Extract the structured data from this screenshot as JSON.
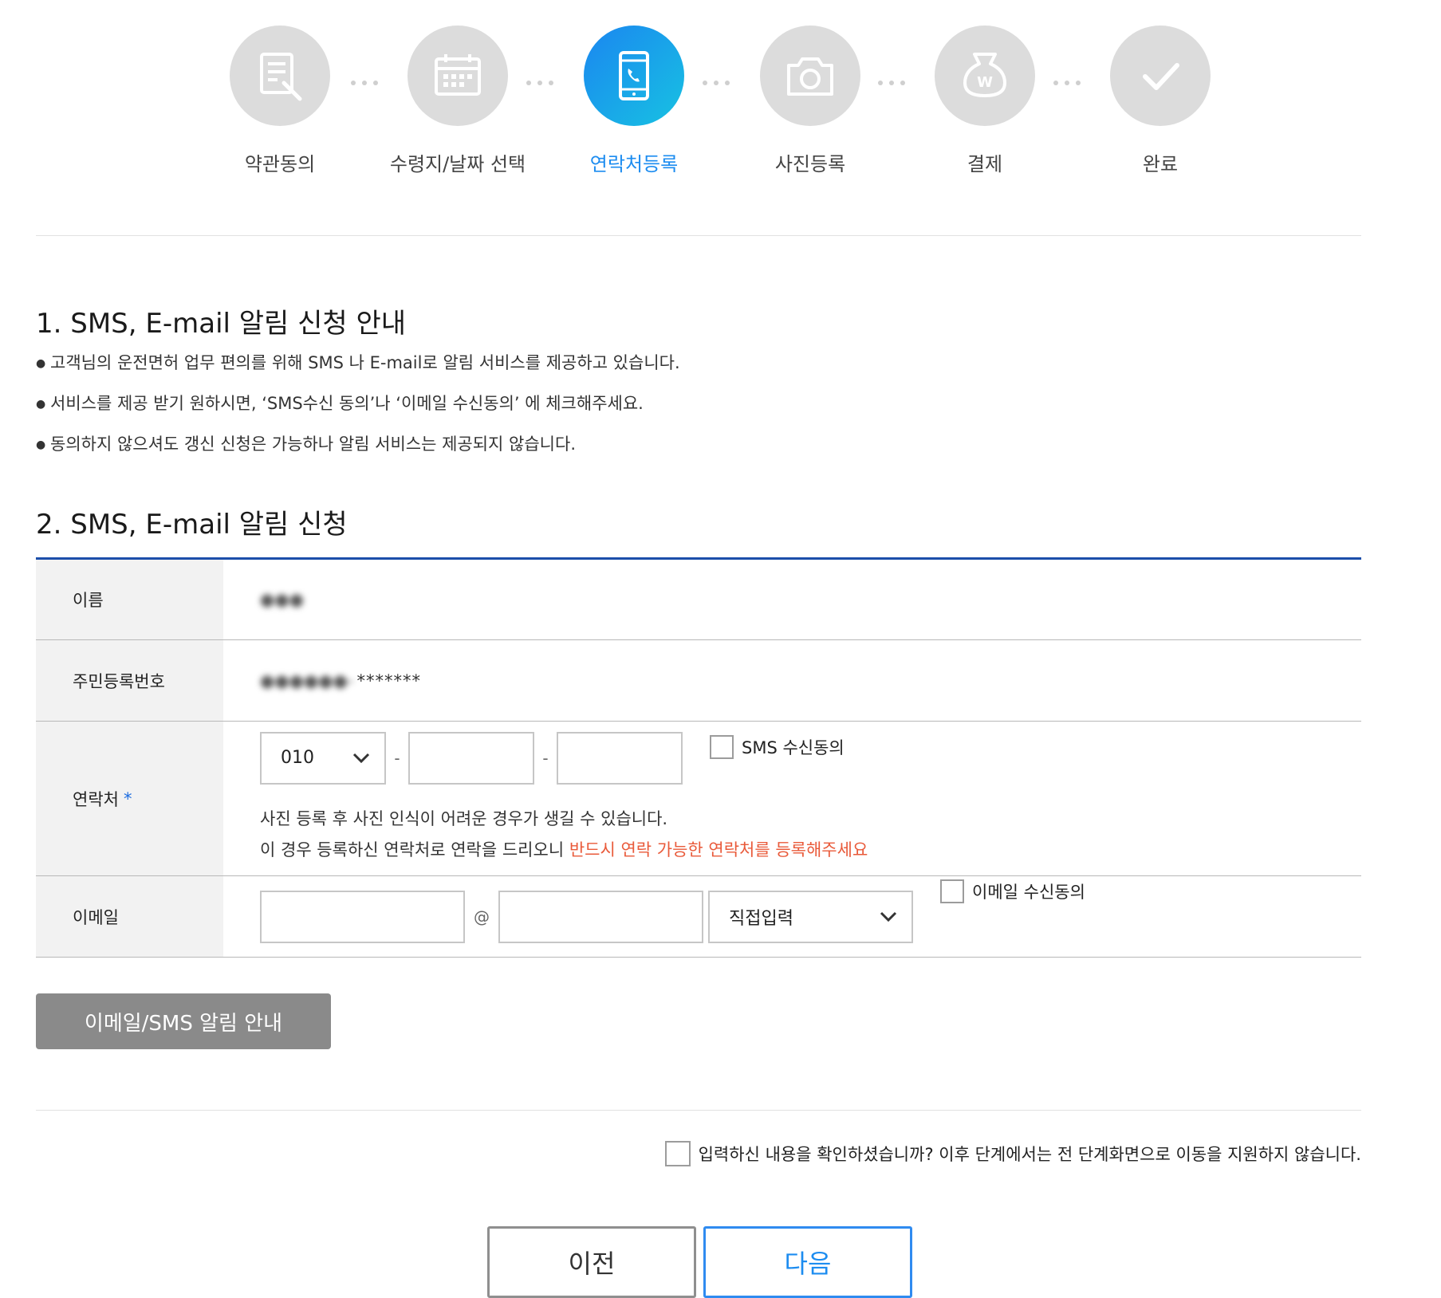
{
  "steps": [
    {
      "label": "약관동의",
      "icon": "document-edit-icon",
      "active": false
    },
    {
      "label": "수령지/날짜 선택",
      "icon": "calendar-icon",
      "active": false
    },
    {
      "label": "연락처등록",
      "icon": "smartphone-call-icon",
      "active": true
    },
    {
      "label": "사진등록",
      "icon": "camera-icon",
      "active": false
    },
    {
      "label": "결제",
      "icon": "won-pouch-icon",
      "active": false
    },
    {
      "label": "완료",
      "icon": "checkmark-icon",
      "active": false
    }
  ],
  "section1": {
    "title": "1. SMS, E-mail 알림 신청 안내",
    "bullets": [
      "고객님의 운전면허 업무 편의를 위해 SMS 나 E-mail로 알림 서비스를 제공하고 있습니다.",
      "서비스를 제공 받기 원하시면, ‘SMS수신 동의’나 ‘이메일 수신동의’ 에 체크해주세요.",
      "동의하지 않으셔도 갱신 신청은 가능하나 알림 서비스는 제공되지 않습니다."
    ]
  },
  "section2": {
    "title": "2. SMS, E-mail 알림 신청",
    "name": {
      "label": "이름",
      "value": "●●●"
    },
    "rrn": {
      "label": "주민등록번호",
      "value_masked": "●●●●●●-",
      "stars": "*******"
    },
    "phone": {
      "label": "연락처",
      "required_mark": "*",
      "prefix": "010",
      "separator": "-",
      "middle": "",
      "last": "",
      "sms_consent_label": "SMS 수신동의",
      "sms_consent_checked": false,
      "notice_line1": "사진 등록 후 사진 인식이 어려운 경우가 생길 수 있습니다.",
      "notice_line2_prefix": "이 경우 등록하신 연락처로 연락을 드리오니 ",
      "notice_line2_highlight": "반드시 연락 가능한 연락처를 등록해주세요"
    },
    "email": {
      "label": "이메일",
      "local": "",
      "at": "@",
      "domain": "",
      "domain_select": "직접입력",
      "consent_label": "이메일 수신동의",
      "consent_checked": false
    }
  },
  "guide_button": "이메일/SMS 알림 안내",
  "confirm": {
    "label": "입력하신 내용을 확인하셨습니까? 이후 단계에서는 전 단계화면으로 이동을 지원하지 않습니다.",
    "checked": false
  },
  "buttons": {
    "prev": "이전",
    "next": "다음"
  },
  "colors": {
    "accent": "#1c8cf0",
    "table_border": "#1c4eaa",
    "warning": "#e95a3a",
    "inactive_step": "#dcdcdc"
  }
}
